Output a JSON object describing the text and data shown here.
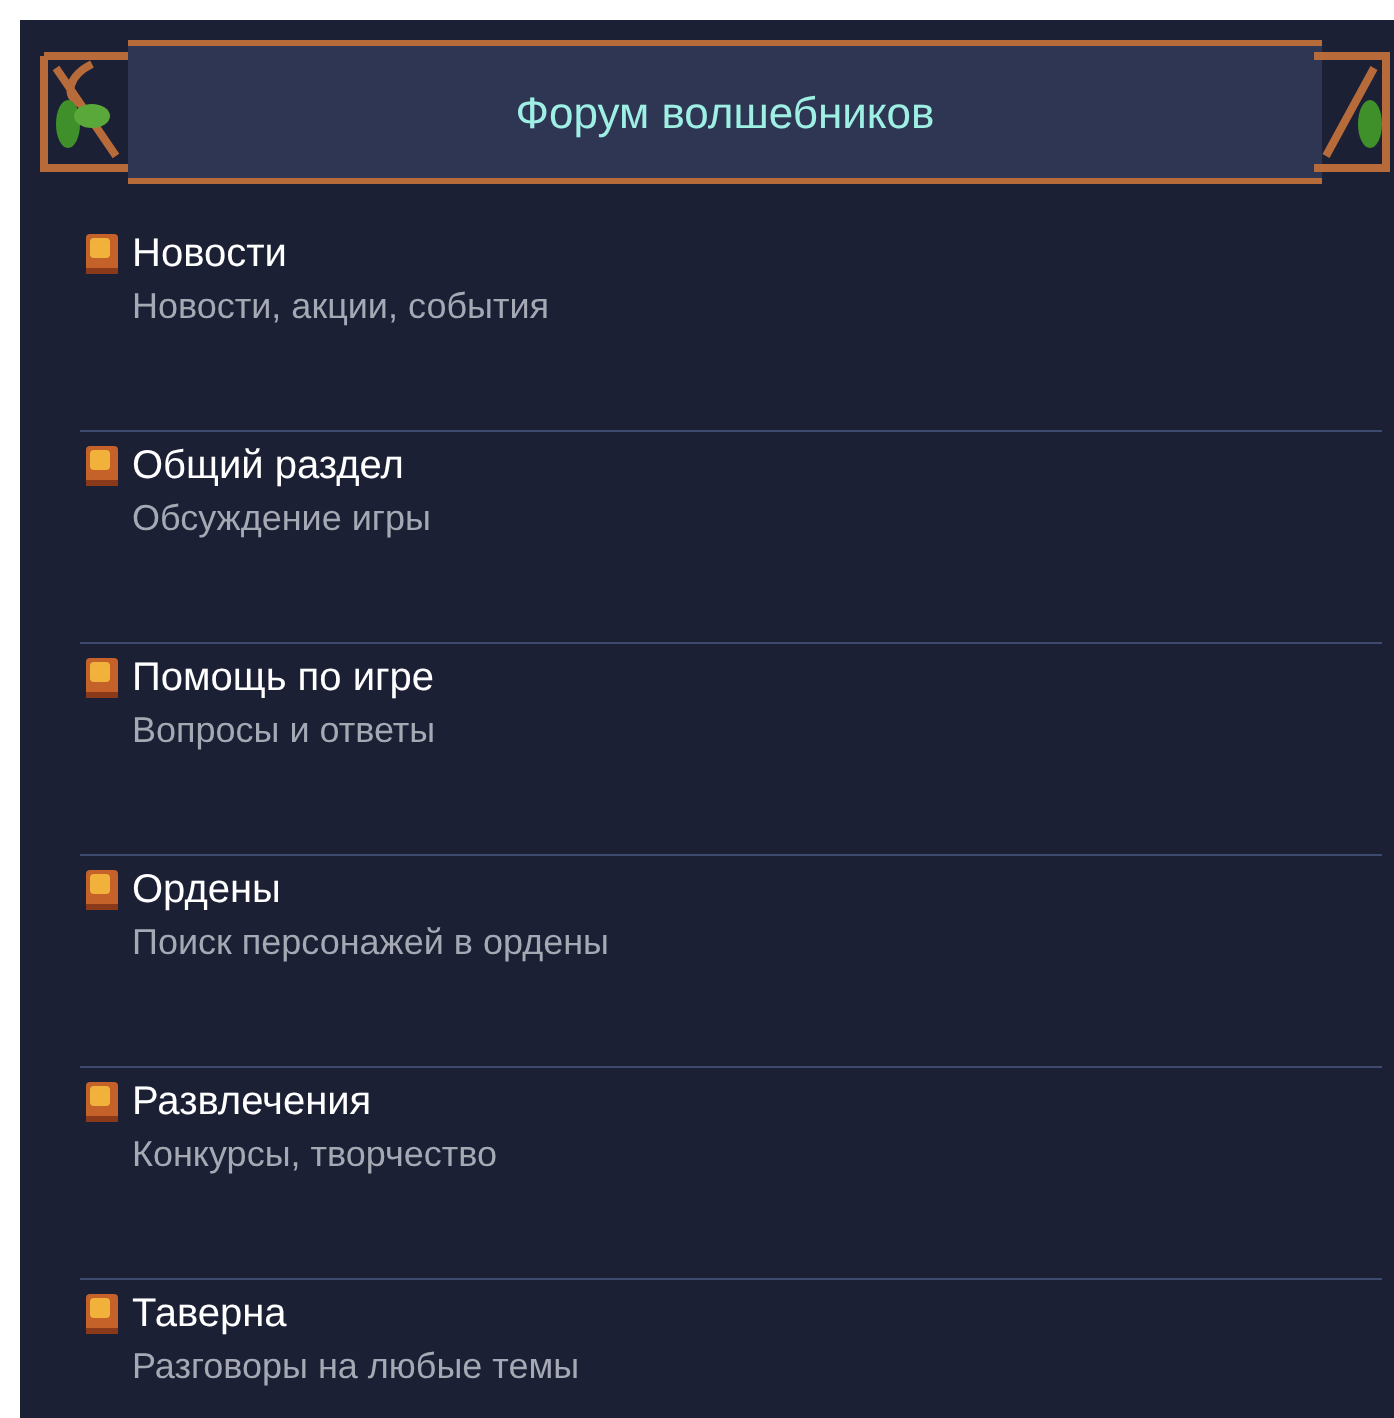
{
  "header": {
    "title": "Форум волшебников"
  },
  "sections": [
    {
      "title": "Новости",
      "subtitle": "Новости, акции, события"
    },
    {
      "title": "Общий раздел",
      "subtitle": "Обсуждение игры"
    },
    {
      "title": "Помощь по игре",
      "subtitle": "Вопросы и ответы"
    },
    {
      "title": "Ордены",
      "subtitle": "Поиск персонажей в ордены"
    },
    {
      "title": "Развлечения",
      "subtitle": "Конкурсы, творчество"
    },
    {
      "title": "Таверна",
      "subtitle": "Разговоры на любые темы"
    }
  ]
}
